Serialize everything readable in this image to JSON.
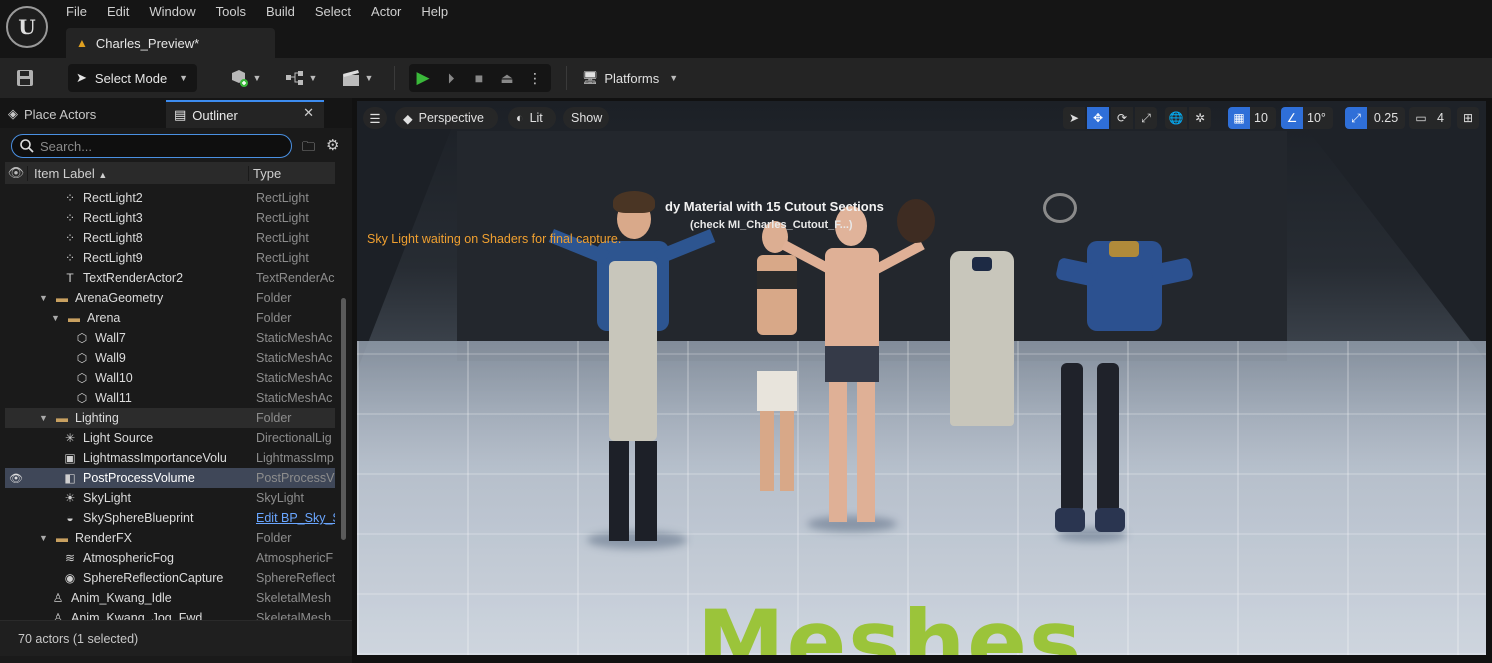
{
  "menu": {
    "logo": "U",
    "items": [
      "File",
      "Edit",
      "Window",
      "Tools",
      "Build",
      "Select",
      "Actor",
      "Help"
    ]
  },
  "document_tab": {
    "label": "Charles_Preview*"
  },
  "toolbar": {
    "select_mode_label": "Select Mode",
    "platforms_label": "Platforms"
  },
  "panel": {
    "tabs": [
      "Place Actors",
      "Outliner"
    ],
    "search_placeholder": "Search...",
    "columns": {
      "label": "Item Label",
      "sort_indicator": "▲",
      "type": "Type"
    },
    "status": "70 actors (1 selected)"
  },
  "outliner_rows": [
    {
      "label": "RectLight2",
      "type": "RectLight",
      "icon": "rect-light-icon",
      "level": 2
    },
    {
      "label": "RectLight3",
      "type": "RectLight",
      "icon": "rect-light-icon",
      "level": 2
    },
    {
      "label": "RectLight8",
      "type": "RectLight",
      "icon": "rect-light-icon",
      "level": 2
    },
    {
      "label": "RectLight9",
      "type": "RectLight",
      "icon": "rect-light-icon",
      "level": 2
    },
    {
      "label": "TextRenderActor2",
      "type": "TextRenderAc",
      "icon": "text-render-icon",
      "level": 2
    },
    {
      "label": "ArenaGeometry",
      "type": "Folder",
      "icon": "folder-icon",
      "level": 1,
      "expanded": true
    },
    {
      "label": "Arena",
      "type": "Folder",
      "icon": "folder-icon",
      "level": 2,
      "expanded": true
    },
    {
      "label": "Wall7",
      "type": "StaticMeshAc",
      "icon": "static-mesh-icon",
      "level": 3
    },
    {
      "label": "Wall9",
      "type": "StaticMeshAc",
      "icon": "static-mesh-icon",
      "level": 3
    },
    {
      "label": "Wall10",
      "type": "StaticMeshAc",
      "icon": "static-mesh-icon",
      "level": 3
    },
    {
      "label": "Wall11",
      "type": "StaticMeshAc",
      "icon": "static-mesh-icon",
      "level": 3
    },
    {
      "label": "Lighting",
      "type": "Folder",
      "icon": "folder-icon",
      "level": 1,
      "expanded": true,
      "highlight": true
    },
    {
      "label": "Light Source",
      "type": "DirectionalLig",
      "icon": "directional-light-icon",
      "level": 2
    },
    {
      "label": "LightmassImportanceVolu",
      "type": "LightmassImp",
      "icon": "volume-icon",
      "level": 2
    },
    {
      "label": "PostProcessVolume",
      "type": "PostProcessV",
      "icon": "post-process-icon",
      "level": 2,
      "selected": true
    },
    {
      "label": "SkyLight",
      "type": "SkyLight",
      "icon": "sky-light-icon",
      "level": 2
    },
    {
      "label": "SkySphereBlueprint",
      "type": "Edit BP_Sky_S",
      "icon": "sky-sphere-icon",
      "level": 2,
      "link": true
    },
    {
      "label": "RenderFX",
      "type": "Folder",
      "icon": "folder-icon",
      "level": 1,
      "expanded": true
    },
    {
      "label": "AtmosphericFog",
      "type": "AtmosphericF",
      "icon": "fog-icon",
      "level": 2
    },
    {
      "label": "SphereReflectionCapture",
      "type": "SphereReflect",
      "icon": "reflection-capture-icon",
      "level": 2
    },
    {
      "label": "Anim_Kwang_Idle",
      "type": "SkeletalMesh",
      "icon": "skeletal-mesh-icon",
      "level": 1
    },
    {
      "label": "Anim_Kwang_Jog_Fwd",
      "type": "SkeletalMesh",
      "icon": "skeletal-mesh-icon",
      "level": 1
    }
  ],
  "viewport": {
    "perspective_label": "Perspective",
    "lit_label": "Lit",
    "show_label": "Show",
    "grid_snap": "10",
    "rotation_snap": "10°",
    "scale_snap": "0.25",
    "camera_speed": "4",
    "warning": "Sky Light waiting on Shaders for final capture.",
    "scene_title": "dy Material with 15 Cutout Sections",
    "scene_subtitle": "(check MI_Charles_Cutout_F...)",
    "floor_text": "Meshes",
    "warning_color": "#f0a030",
    "floor_text_color": "#9bc43a"
  },
  "colors": {
    "accent": "#3d8cf0",
    "play": "#3ab83a",
    "selected_row": "#3f4758"
  }
}
